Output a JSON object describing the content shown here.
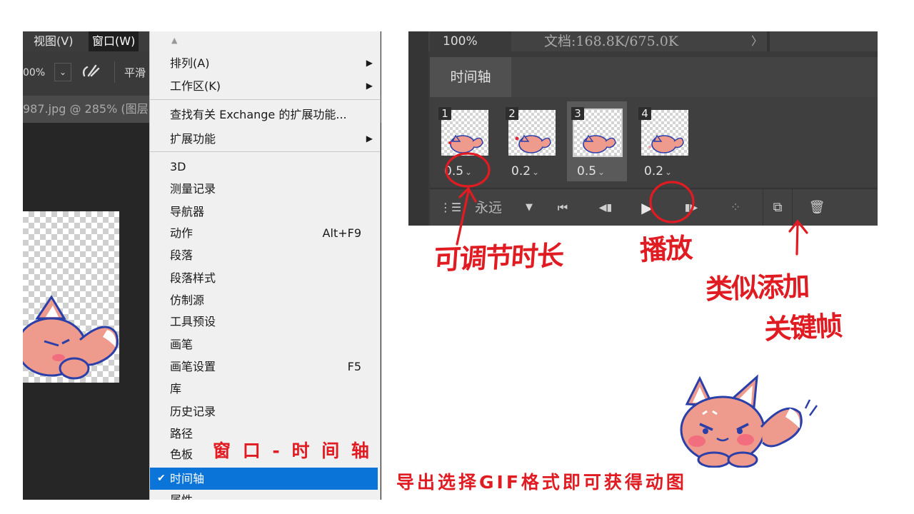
{
  "menubar": {
    "view": "视图(V)",
    "window": "窗口(W)"
  },
  "options_bar": {
    "zoom": "00%",
    "dropdown": "⌄",
    "brush_glyph": "ℭ",
    "smooth": "平滑"
  },
  "doc_tab": {
    "label": "987.jpg @ 285% (图层"
  },
  "window_menu": {
    "scroll_up": "▲",
    "items": [
      {
        "label": "排列(A)",
        "submenu": true
      },
      {
        "label": "工作区(K)",
        "submenu": true
      },
      {
        "label": "查找有关 Exchange 的扩展功能..."
      },
      {
        "label": "扩展功能",
        "submenu": true
      },
      {
        "label": "3D"
      },
      {
        "label": "测量记录"
      },
      {
        "label": "导航器"
      },
      {
        "label": "动作",
        "shortcut": "Alt+F9"
      },
      {
        "label": "段落"
      },
      {
        "label": "段落样式"
      },
      {
        "label": "仿制源"
      },
      {
        "label": "工具预设"
      },
      {
        "label": "画笔"
      },
      {
        "label": "画笔设置",
        "shortcut": "F5"
      },
      {
        "label": "库"
      },
      {
        "label": "历史记录"
      },
      {
        "label": "路径"
      },
      {
        "label": "色板"
      },
      {
        "label": "时间轴",
        "checked": true,
        "selected": true
      },
      {
        "label": "属性"
      }
    ],
    "arrow_glyph": "▶",
    "check_glyph": "✔"
  },
  "timeline_panel": {
    "zoom": "100%",
    "doc_info": "文档:168.8K/675.0K",
    "doc_arrow": "〉",
    "tab": "时间轴",
    "frames": [
      {
        "number": "1",
        "delay": "0.5",
        "selected": false
      },
      {
        "number": "2",
        "delay": "0.2",
        "selected": false
      },
      {
        "number": "3",
        "delay": "0.5",
        "selected": true
      },
      {
        "number": "4",
        "delay": "0.2",
        "selected": false
      }
    ],
    "delay_chevron": "⌄",
    "controls": {
      "loop_icon": "⋮☰",
      "loop_value": "永远",
      "loop_dropdown": "▼",
      "first_frame": "⏮",
      "prev_frame": "◀▮",
      "play": "▶",
      "next_frame": "▮▶",
      "tween": "⁘",
      "duplicate_frame": "⧉",
      "delete_frame": "🗑"
    }
  },
  "annotations": {
    "adjust_duration": "可调节时长",
    "play": "播放",
    "add_keyframe_line1": "类似添加",
    "add_keyframe_line2": "关键帧",
    "window_timeline": "窗 口 - 时 间 轴",
    "export_note": "导出选择GIF格式即可获得动图",
    "color": "#e11b22"
  },
  "colors": {
    "menu_highlight": "#0a74d8",
    "ps_dark": "#282828",
    "fox_body": "#ee9a8c",
    "fox_outline": "#2a3fa8"
  }
}
